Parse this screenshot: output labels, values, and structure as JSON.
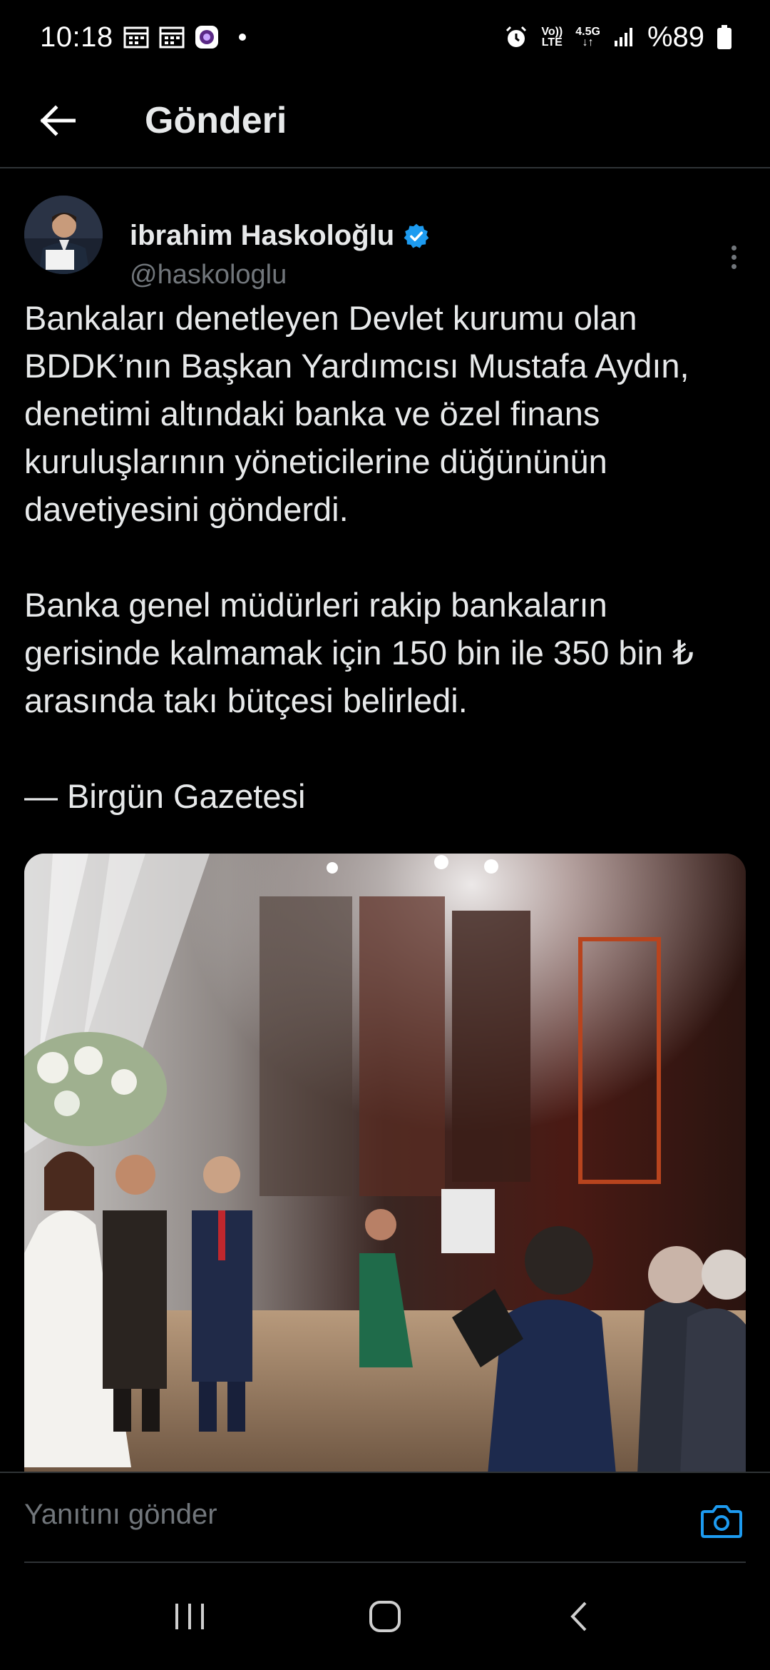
{
  "status_bar": {
    "time": "10:18",
    "battery_percent": "%89",
    "network_volte": "Vo))\nLTE",
    "network_type": "4.5G",
    "icons": [
      "calendar-icon",
      "calendar-icon",
      "app-icon",
      "alarm-icon",
      "signal-icon",
      "battery-icon"
    ]
  },
  "header": {
    "title": "Gönderi",
    "back_icon": "arrow-left-icon"
  },
  "post": {
    "author_name": "ibrahim Haskoloğlu",
    "verified": true,
    "author_handle": "@haskologlu",
    "paragraph1": "Bankaları denetleyen Devlet kurumu olan BDDK’nın Başkan Yardımcısı Mustafa Aydın, denetimi altındaki banka ve özel finans kuruluşlarının yöneticilerine düğününün davetiyesini gönderdi.",
    "paragraph2": "Banka genel müdürleri rakip bankaların gerisinde kalmamak için 150 bin ile 350 bin ₺ arasında takı bütçesi belirledi.",
    "paragraph3": "— Birgün Gazetesi"
  },
  "reply": {
    "placeholder": "Yanıtını gönder"
  },
  "colors": {
    "background": "#000000",
    "text": "#e7e9ea",
    "muted": "#71767b",
    "accent": "#1d9bf0",
    "divider": "#2f3336"
  }
}
